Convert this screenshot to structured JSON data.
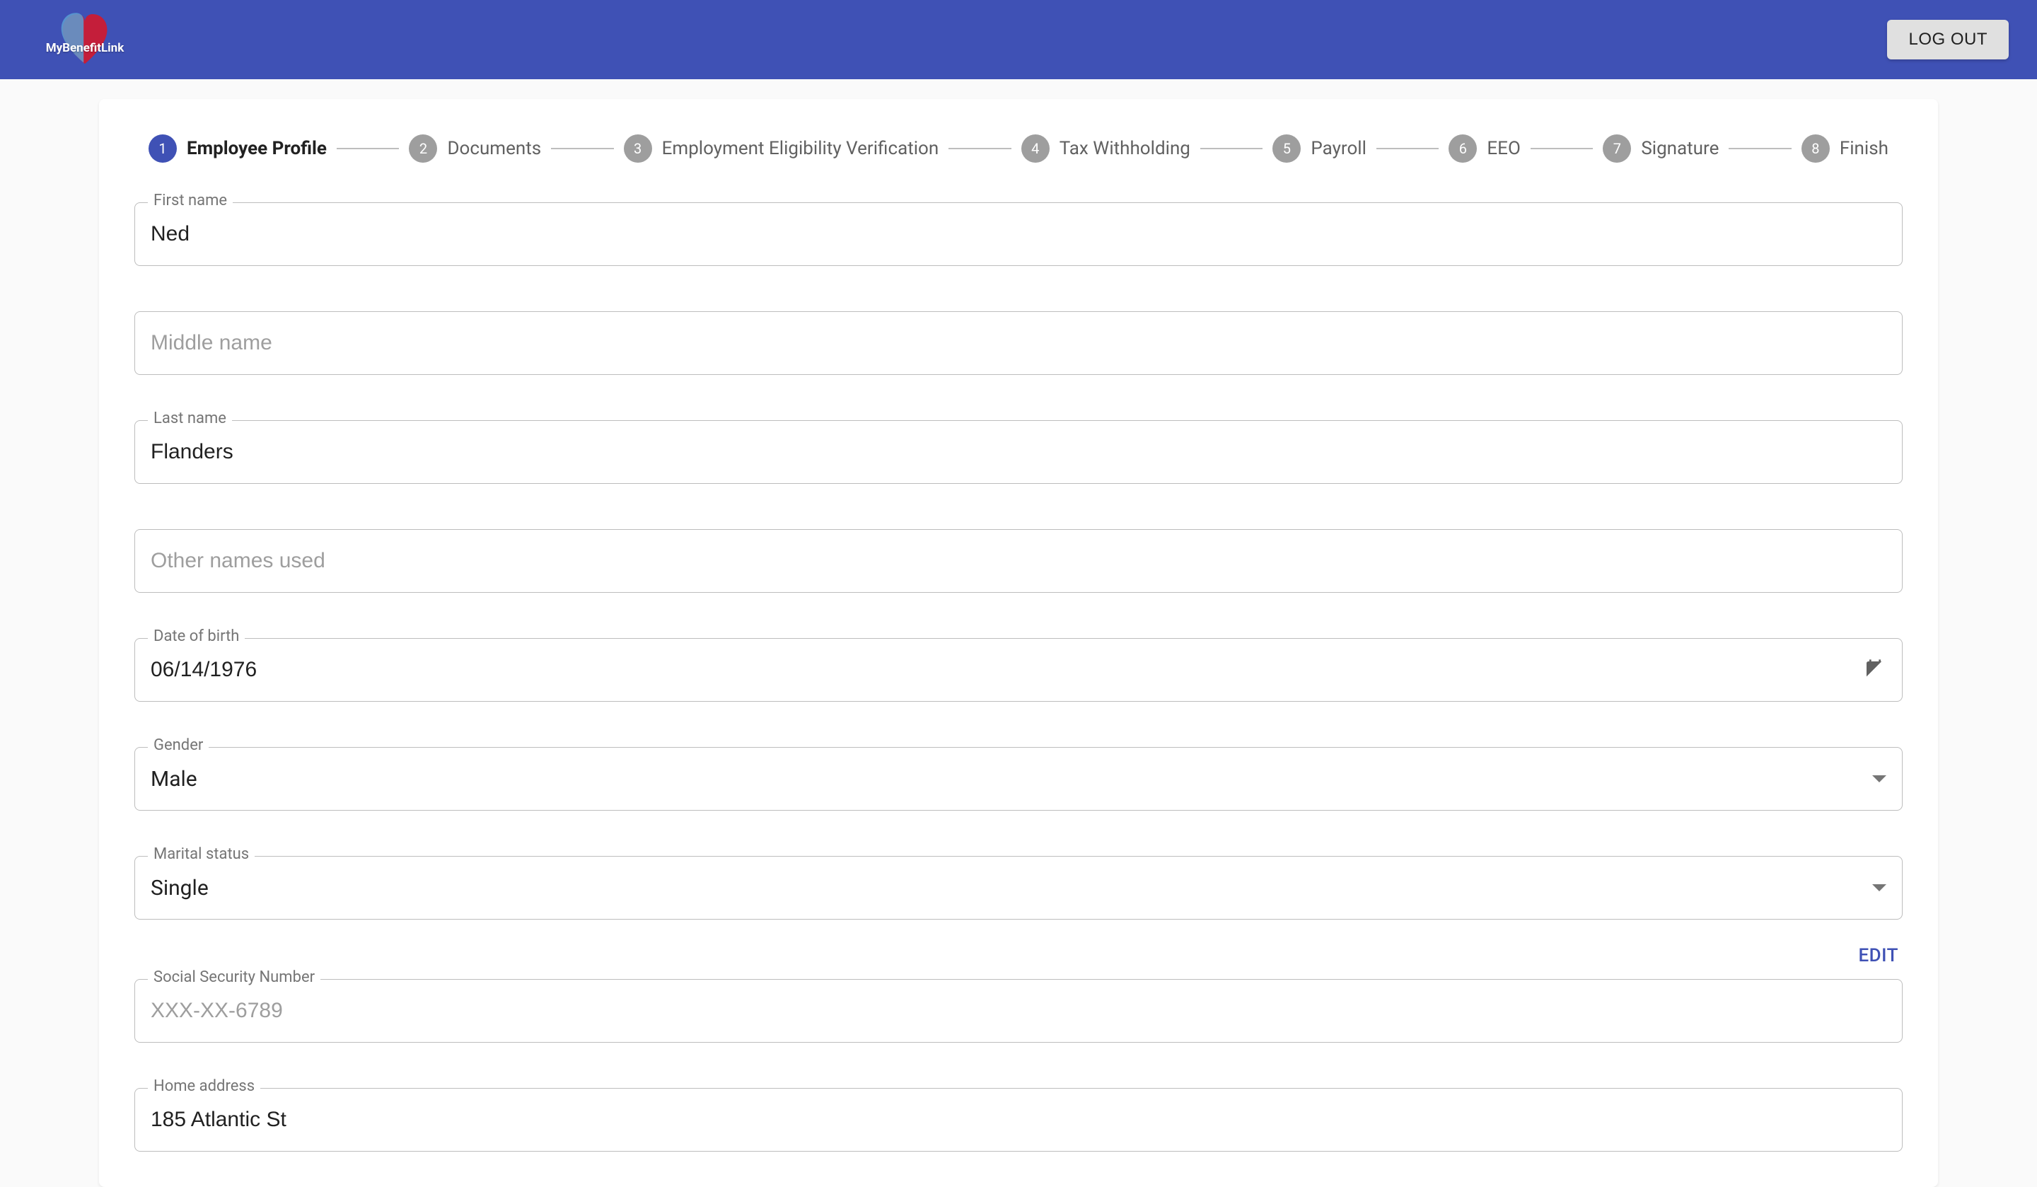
{
  "header": {
    "logo_text": "MyBenefitLink",
    "logout_label": "LOG OUT"
  },
  "stepper": {
    "steps": [
      {
        "num": "1",
        "label": "Employee Profile",
        "active": true
      },
      {
        "num": "2",
        "label": "Documents",
        "active": false
      },
      {
        "num": "3",
        "label": "Employment Eligibility Verification",
        "active": false
      },
      {
        "num": "4",
        "label": "Tax Withholding",
        "active": false
      },
      {
        "num": "5",
        "label": "Payroll",
        "active": false
      },
      {
        "num": "6",
        "label": "EEO",
        "active": false
      },
      {
        "num": "7",
        "label": "Signature",
        "active": false
      },
      {
        "num": "8",
        "label": "Finish",
        "active": false
      }
    ]
  },
  "form": {
    "first_name": {
      "label": "First name",
      "value": "Ned"
    },
    "middle_name": {
      "label": "Middle name",
      "value": "",
      "placeholder": "Middle name"
    },
    "last_name": {
      "label": "Last name",
      "value": "Flanders"
    },
    "other_names": {
      "label": "Other names used",
      "value": "",
      "placeholder": "Other names used"
    },
    "dob": {
      "label": "Date of birth",
      "value": "06/14/1976"
    },
    "gender": {
      "label": "Gender",
      "value": "Male"
    },
    "marital_status": {
      "label": "Marital status",
      "value": "Single"
    },
    "ssn": {
      "label": "Social Security Number",
      "value": "",
      "placeholder": "XXX-XX-6789",
      "edit_label": "EDIT"
    },
    "home_address": {
      "label": "Home address",
      "value": "185 Atlantic St"
    }
  }
}
